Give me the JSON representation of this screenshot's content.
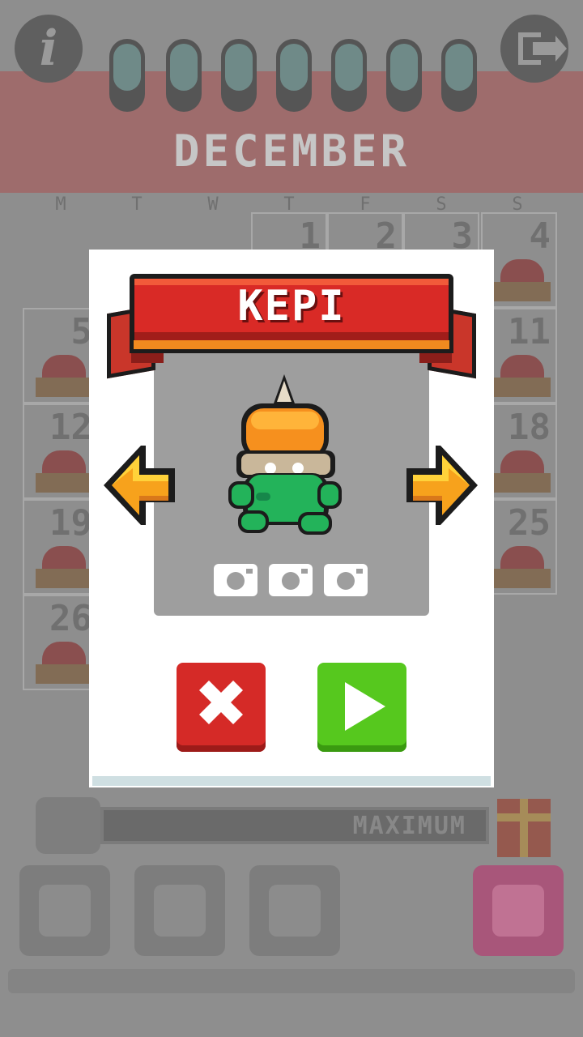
{
  "calendar": {
    "month": "DECEMBER",
    "weekdays": [
      "M",
      "T",
      "W",
      "T",
      "F",
      "S",
      "S"
    ],
    "days": [
      "1",
      "2",
      "3",
      "4",
      "5",
      "11",
      "12",
      "18",
      "19",
      "25",
      "26"
    ]
  },
  "progress": {
    "label": "MAXIMUM"
  },
  "dialog": {
    "character_name": "KEPI",
    "photo_slots": 3
  },
  "colors": {
    "banner": "#d92a26",
    "close": "#d52a27",
    "play": "#56c81e",
    "arrow": "#f7a21c"
  },
  "icons": {
    "info": "info-icon",
    "exit": "exit-icon",
    "prev": "arrow-left-icon",
    "next": "arrow-right-icon",
    "close": "close-icon",
    "play": "play-icon",
    "camera": "camera-icon"
  }
}
